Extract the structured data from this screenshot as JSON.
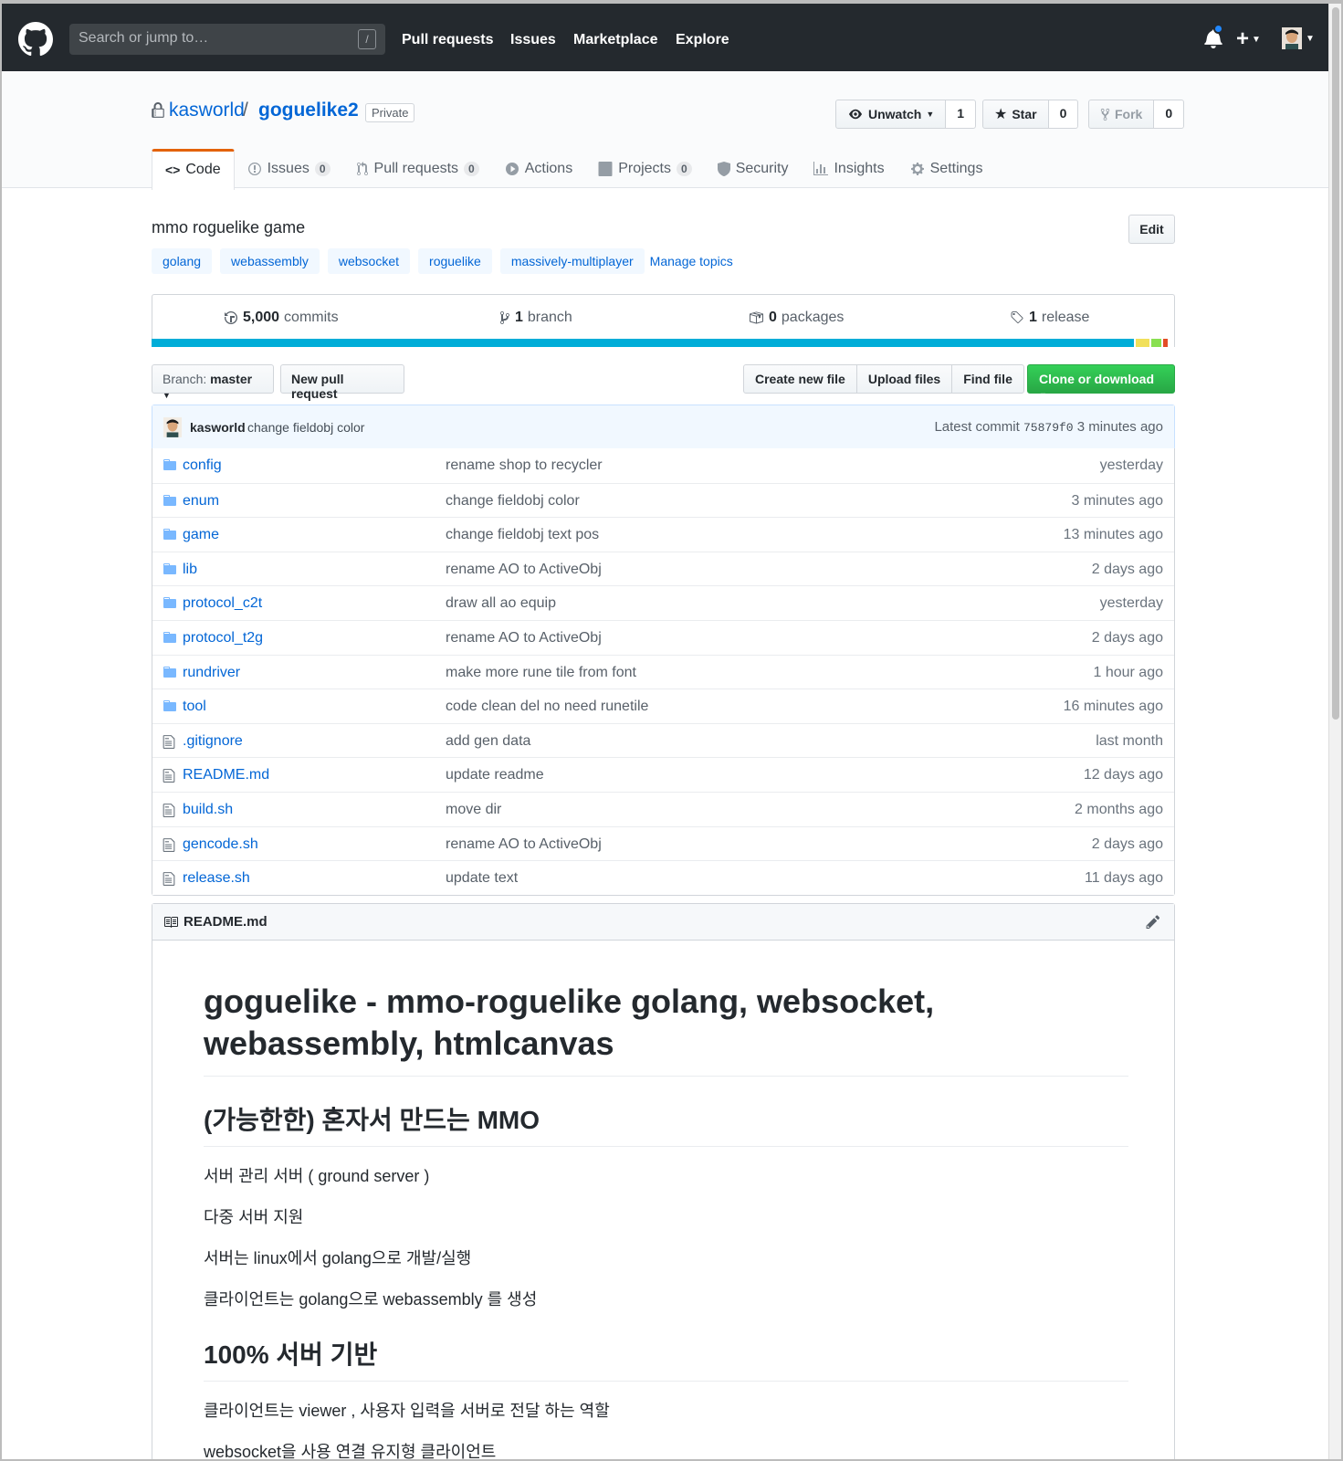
{
  "header": {
    "search_placeholder": "Search or jump to…",
    "search_shortcut": "/",
    "nav": [
      "Pull requests",
      "Issues",
      "Marketplace",
      "Explore"
    ],
    "plus_label": "+"
  },
  "repo": {
    "owner": "kasworld",
    "separator": "/",
    "name": "goguelike2",
    "visibility": "Private",
    "watch": {
      "label": "Unwatch",
      "count": "1"
    },
    "star": {
      "label": "Star",
      "count": "0"
    },
    "fork": {
      "label": "Fork",
      "count": "0"
    }
  },
  "tabs": [
    {
      "label": "Code",
      "selected": true
    },
    {
      "label": "Issues",
      "count": "0"
    },
    {
      "label": "Pull requests",
      "count": "0"
    },
    {
      "label": "Actions"
    },
    {
      "label": "Projects",
      "count": "0"
    },
    {
      "label": "Security"
    },
    {
      "label": "Insights"
    },
    {
      "label": "Settings"
    }
  ],
  "description": "mmo roguelike game",
  "edit_label": "Edit",
  "topics": [
    "golang",
    "webassembly",
    "websocket",
    "roguelike",
    "massively-multiplayer"
  ],
  "manage_topics": "Manage topics",
  "summary": {
    "commits": {
      "num": "5,000",
      "label": "commits"
    },
    "branches": {
      "num": "1",
      "label": "branch"
    },
    "packages": {
      "num": "0",
      "label": "packages"
    },
    "releases": {
      "num": "1",
      "label": "release"
    }
  },
  "language_bar": {
    "segments": [
      {
        "color": "#00add8",
        "percent": 96.0
      },
      {
        "color": "#f1e05a",
        "percent": 1.5
      },
      {
        "color": "#89e051",
        "percent": 1.2
      },
      {
        "color": "#e34c26",
        "percent": 0.6
      }
    ]
  },
  "filenav": {
    "branch_prefix": "Branch:",
    "branch": "master",
    "new_pr": "New pull request",
    "create_file": "Create new file",
    "upload": "Upload files",
    "find": "Find file",
    "clone": "Clone or download"
  },
  "latest_commit": {
    "author": "kasworld",
    "message": "change fieldobj color",
    "prefix": "Latest commit",
    "sha": "75879f0",
    "age": "3 minutes ago"
  },
  "files": [
    {
      "type": "dir",
      "name": "config",
      "message": "rename shop to recycler",
      "age": "yesterday"
    },
    {
      "type": "dir",
      "name": "enum",
      "message": "change fieldobj color",
      "age": "3 minutes ago"
    },
    {
      "type": "dir",
      "name": "game",
      "message": "change fieldobj text pos",
      "age": "13 minutes ago"
    },
    {
      "type": "dir",
      "name": "lib",
      "message": "rename AO to ActiveObj",
      "age": "2 days ago"
    },
    {
      "type": "dir",
      "name": "protocol_c2t",
      "message": "draw all ao equip",
      "age": "yesterday"
    },
    {
      "type": "dir",
      "name": "protocol_t2g",
      "message": "rename AO to ActiveObj",
      "age": "2 days ago"
    },
    {
      "type": "dir",
      "name": "rundriver",
      "message": "make more rune tile from font",
      "age": "1 hour ago"
    },
    {
      "type": "dir",
      "name": "tool",
      "message": "code clean del no need runetile",
      "age": "16 minutes ago"
    },
    {
      "type": "file",
      "name": ".gitignore",
      "message": "add gen data",
      "age": "last month"
    },
    {
      "type": "file",
      "name": "README.md",
      "message": "update readme",
      "age": "12 days ago"
    },
    {
      "type": "file",
      "name": "build.sh",
      "message": "move dir",
      "age": "2 months ago"
    },
    {
      "type": "file",
      "name": "gencode.sh",
      "message": "rename AO to ActiveObj",
      "age": "2 days ago"
    },
    {
      "type": "file",
      "name": "release.sh",
      "message": "update text",
      "age": "11 days ago"
    }
  ],
  "readme": {
    "filename": "README.md",
    "h1": "goguelike - mmo-roguelike golang, websocket, webassembly, htmlcanvas",
    "h2a": "(가능한한) 혼자서 만드는 MMO",
    "p1": "서버 관리 서버 ( ground server )",
    "p2": "다중 서버 지원",
    "p3": "서버는 linux에서 golang으로 개발/실행",
    "p4": "클라이언트는 golang으로 webassembly 를 생성",
    "h2b": "100% 서버 기반",
    "p5": "클라이언트는 viewer , 사용자 입력을 서버로 전달 하는 역할",
    "p6": "websocket을 사용 연결 유지형 클라이언트"
  }
}
